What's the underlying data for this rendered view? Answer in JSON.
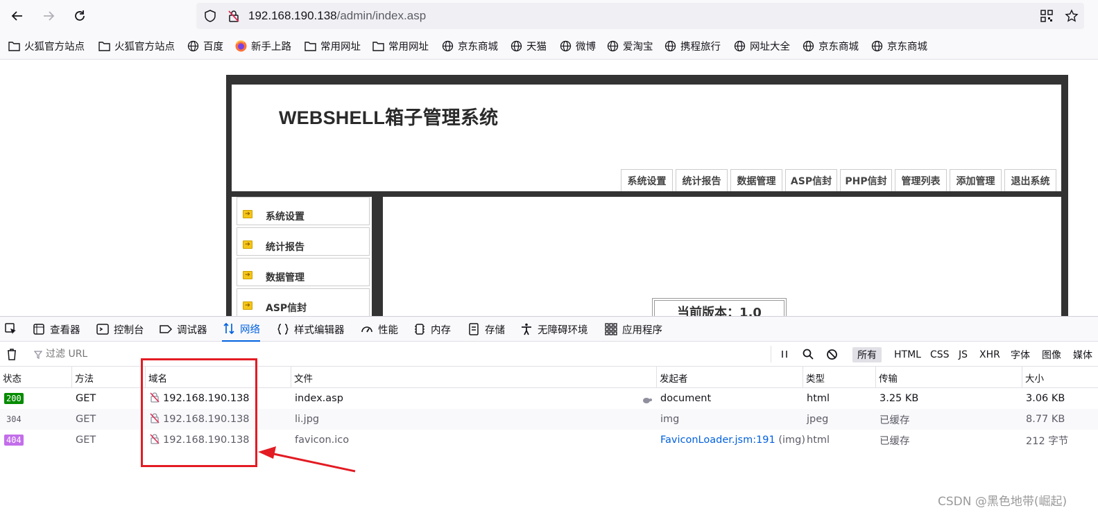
{
  "browser": {
    "url_host": "192.168.190.138",
    "url_path": "/admin/index.asp"
  },
  "bookmarks": [
    {
      "label": "火狐官方站点",
      "icon": "folder-icon"
    },
    {
      "label": "火狐官方站点",
      "icon": "folder-icon"
    },
    {
      "label": "百度",
      "icon": "globe-icon"
    },
    {
      "label": "新手上路",
      "icon": "firefox-icon"
    },
    {
      "label": "常用网址",
      "icon": "folder-icon"
    },
    {
      "label": "常用网址",
      "icon": "folder-icon"
    },
    {
      "label": "京东商城",
      "icon": "globe-icon"
    },
    {
      "label": "天猫",
      "icon": "globe-icon"
    },
    {
      "label": "微博",
      "icon": "globe-icon"
    },
    {
      "label": "爱淘宝",
      "icon": "globe-icon"
    },
    {
      "label": "携程旅行",
      "icon": "globe-icon"
    },
    {
      "label": "网址大全",
      "icon": "globe-icon"
    },
    {
      "label": "京东商城",
      "icon": "globe-icon"
    },
    {
      "label": "京东商城",
      "icon": "globe-icon"
    }
  ],
  "site": {
    "title": "WEBSHELL箱子管理系统",
    "topnav": [
      "系统设置",
      "统计报告",
      "数据管理",
      "ASP信封",
      "PHP信封",
      "管理列表",
      "添加管理",
      "退出系统"
    ],
    "sidebar": [
      "系统设置",
      "统计报告",
      "数据管理",
      "ASP信封"
    ],
    "version_label": "当前版本：1.0"
  },
  "devtools": {
    "tabs": [
      {
        "label": "查看器",
        "icon": "inspector-icon"
      },
      {
        "label": "控制台",
        "icon": "console-icon"
      },
      {
        "label": "调试器",
        "icon": "debugger-icon"
      },
      {
        "label": "网络",
        "icon": "network-icon"
      },
      {
        "label": "样式编辑器",
        "icon": "style-editor-icon"
      },
      {
        "label": "性能",
        "icon": "performance-icon"
      },
      {
        "label": "内存",
        "icon": "memory-icon"
      },
      {
        "label": "存储",
        "icon": "storage-icon"
      },
      {
        "label": "无障碍环境",
        "icon": "accessibility-icon"
      },
      {
        "label": "应用程序",
        "icon": "application-icon"
      }
    ],
    "active_tab": "网络",
    "filter_placeholder": "过滤 URL",
    "type_filters": [
      "所有",
      "HTML",
      "CSS",
      "JS",
      "XHR",
      "字体",
      "图像",
      "媒体"
    ],
    "selected_filter": "所有",
    "columns": [
      "状态",
      "方法",
      "域名",
      "文件",
      "发起者",
      "类型",
      "传输",
      "大小"
    ],
    "rows": [
      {
        "status": "200",
        "method": "GET",
        "domain": "192.168.190.138",
        "file": "index.asp",
        "initiator": "document",
        "initiator_link": "",
        "initiator_suffix": "",
        "type": "html",
        "transferred": "3.25 KB",
        "size": "3.06 KB"
      },
      {
        "status": "304",
        "method": "GET",
        "domain": "192.168.190.138",
        "file": "li.jpg",
        "initiator": "img",
        "initiator_link": "",
        "initiator_suffix": "",
        "type": "jpeg",
        "transferred": "已缓存",
        "size": "8.77 KB"
      },
      {
        "status": "404",
        "method": "GET",
        "domain": "192.168.190.138",
        "file": "favicon.ico",
        "initiator": "",
        "initiator_link": "FaviconLoader.jsm:191",
        "initiator_suffix": " (img)",
        "type": "html",
        "transferred": "已缓存",
        "size": "212 字节"
      }
    ]
  },
  "watermark": "CSDN @黑色地带(崛起)",
  "colors": {
    "status_200": "#058b00",
    "status_404": "#c36eea",
    "active_tab": "#0061e0",
    "annotation": "#e31b23",
    "link": "#0060df"
  }
}
